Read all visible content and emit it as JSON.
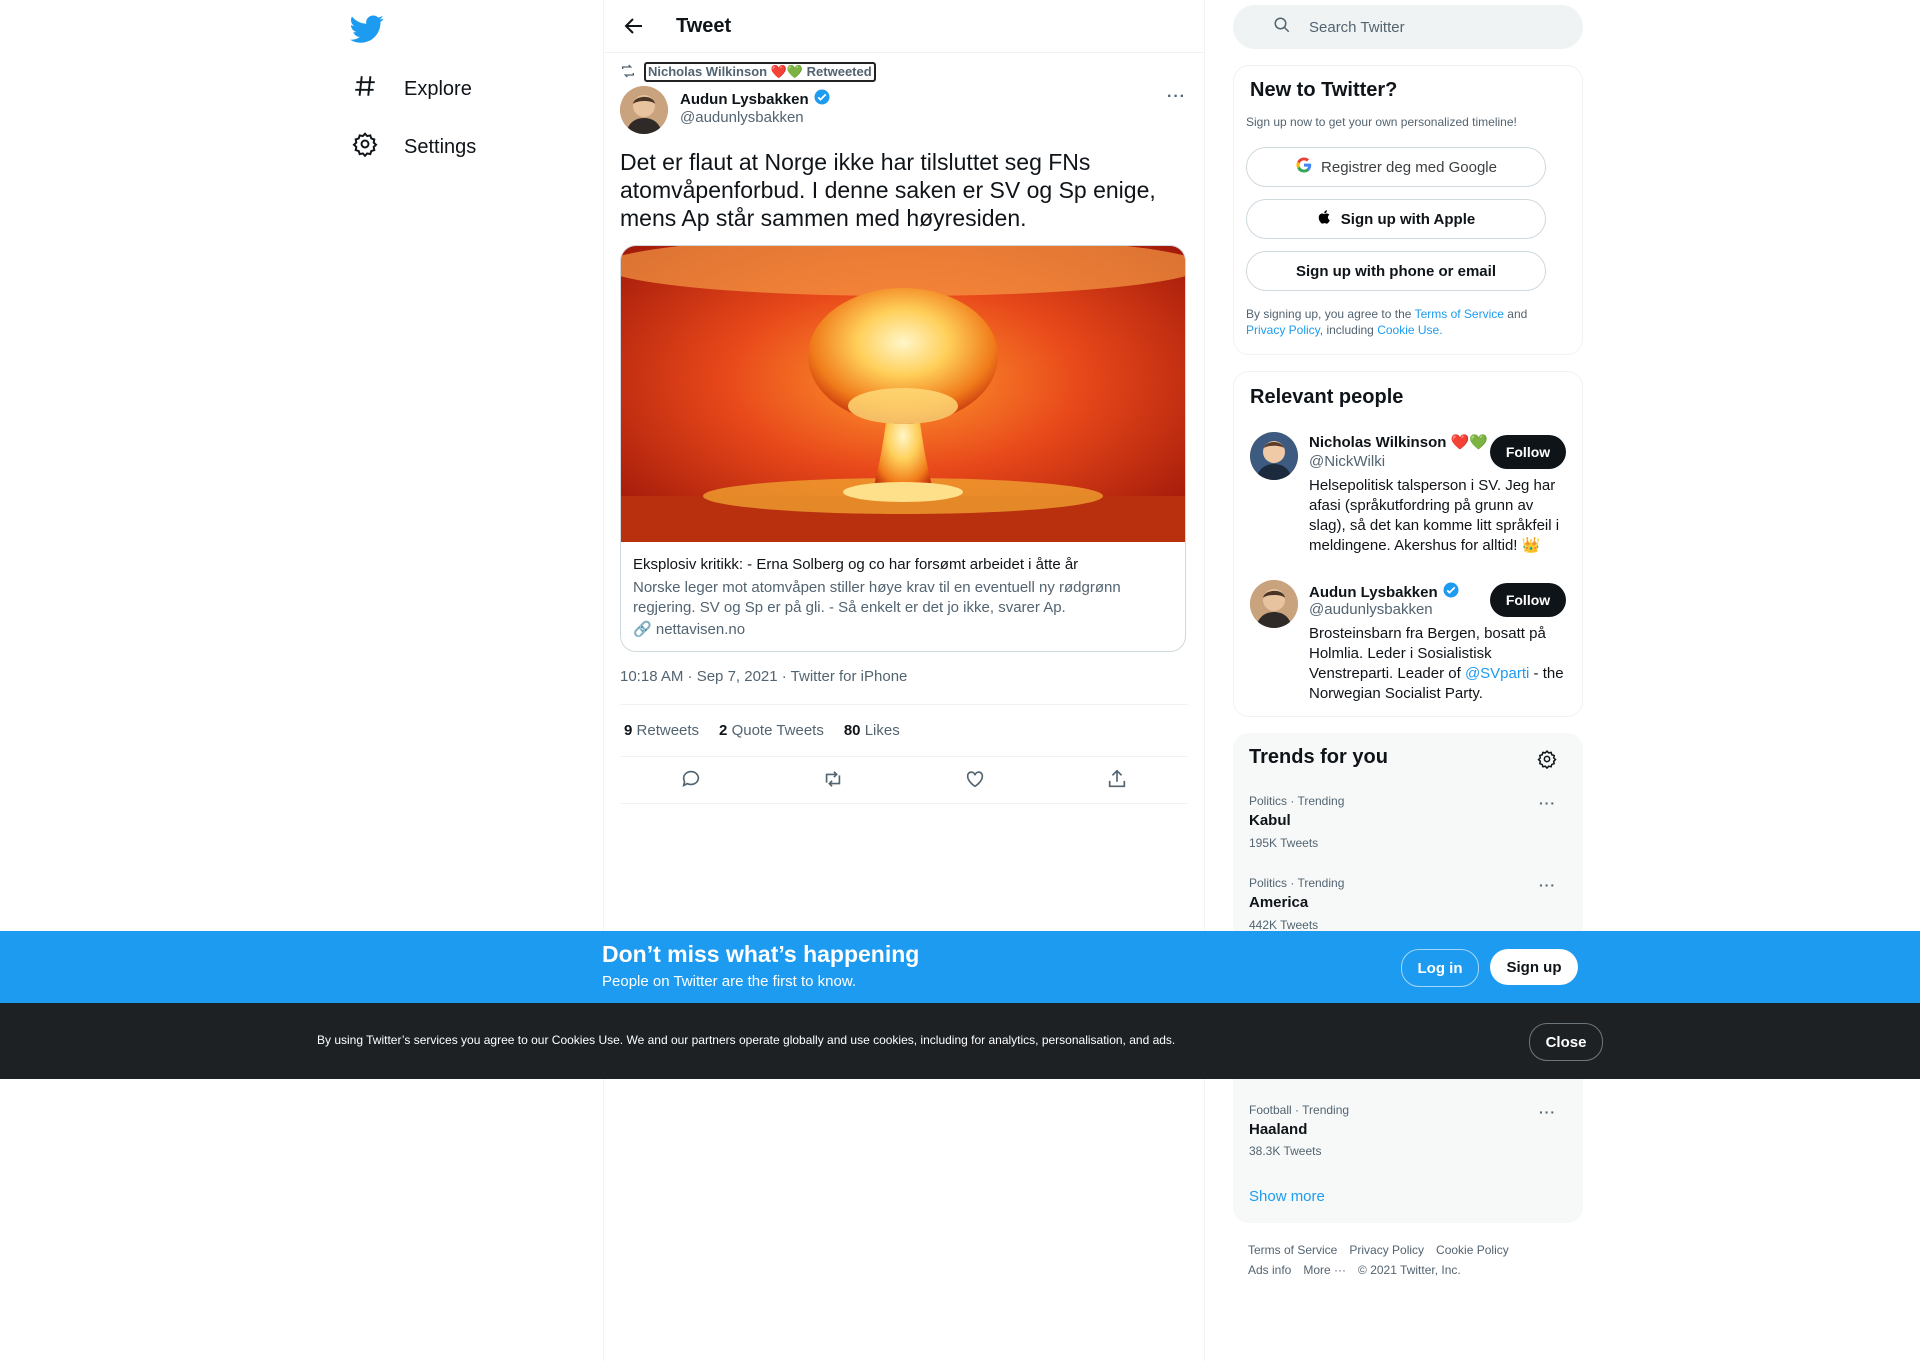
{
  "nav": {
    "items": [
      {
        "label": "Explore",
        "icon": "hashtag-icon"
      },
      {
        "label": "Settings",
        "icon": "gear-icon"
      }
    ]
  },
  "header": {
    "title": "Tweet"
  },
  "tweet": {
    "retweeted_by": "Nicholas Wilkinson ❤️💚 Retweeted",
    "author_name": "Audun Lysbakken",
    "author_handle": "@audunlysbakken",
    "text": "Det er flaut at Norge ikke har tilsluttet seg FNs atomvåpenforbud. I denne saken er SV og Sp enige, mens Ap står sammen med høyresiden.",
    "card": {
      "title": "Eksplosiv kritikk: - Erna Solberg og co har forsømt arbeidet i åtte år",
      "description": "Norske leger mot atomvåpen stiller høye krav til en eventuell ny rødgrønn regjering. SV og Sp er på gli. - Så enkelt er det jo ikke, svarer Ap.",
      "domain": "nettavisen.no"
    },
    "meta": "10:18 AM · Sep 7, 2021 · Twitter for iPhone",
    "stats": {
      "retweets": "9",
      "retweets_label": "Retweets",
      "quotes": "2",
      "quotes_label": "Quote Tweets",
      "likes": "80",
      "likes_label": "Likes"
    }
  },
  "search": {
    "placeholder": "Search Twitter"
  },
  "new_to_twitter": {
    "title": "New to Twitter?",
    "subtitle": "Sign up now to get your own personalized timeline!",
    "google_btn": "Registrer deg med Google",
    "apple_btn": "Sign up with Apple",
    "phone_btn": "Sign up with phone or email",
    "terms_prefix": "By signing up, you agree to the",
    "terms_link": "Terms of Service",
    "terms_and": "and",
    "privacy_link": "Privacy Policy",
    "including": ", including",
    "cookie_link": "Cookie Use."
  },
  "relevant_people": {
    "title": "Relevant people",
    "people": [
      {
        "name": "Nicholas Wilkinson ❤️💚",
        "handle": "@NickWilki",
        "bio": "Helsepolitisk talsperson i SV. Jeg har afasi (språkutfordring på grunn av slag), så det kan komme litt språkfeil i meldingene. Akershus for alltid! 👑",
        "follow": "Follow"
      },
      {
        "name": "Audun Lysbakken",
        "handle": "@audunlysbakken",
        "bio_pre": "Brosteinsbarn fra Bergen, bosatt på Holmlia. Leder i Sosialistisk Venstreparti. Leader of",
        "bio_link": "@SVparti",
        "bio_post": "- the Norwegian Socialist Party.",
        "follow": "Follow"
      }
    ]
  },
  "trends": {
    "title": "Trends for you",
    "items": [
      {
        "category": "Politics · Trending",
        "name": "Kabul",
        "count": "195K Tweets"
      },
      {
        "category": "Politics · Trending",
        "name": "America",
        "count": "442K Tweets"
      },
      {
        "category": "Football · Trending",
        "name": "Haaland",
        "count": "38.3K Tweets"
      }
    ],
    "show_more": "Show more"
  },
  "footer": {
    "row1": [
      "Terms of Service",
      "Privacy Policy",
      "Cookie Policy"
    ],
    "row2": [
      "Ads info",
      "More ···",
      "© 2021 Twitter, Inc."
    ]
  },
  "banner": {
    "title": "Don’t miss what’s happening",
    "subtitle": "People on Twitter are the first to know.",
    "login": "Log in",
    "signup": "Sign up"
  },
  "cookie_banner": {
    "text": "By using Twitter’s services you agree to our Cookies Use. We and our partners operate globally and use cookies, including for analytics, personalisation, and ads.",
    "close": "Close"
  },
  "colors": {
    "accent": "#1d9bf0",
    "text": "#0f1419",
    "muted": "#536471"
  }
}
